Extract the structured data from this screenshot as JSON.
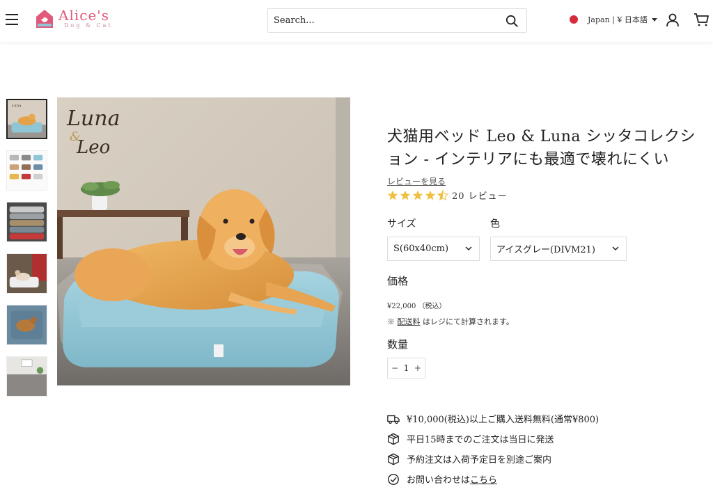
{
  "header": {
    "logo_name": "Alice's",
    "logo_sub": "Dog & Cat",
    "search_placeholder": "Search...",
    "locale_label": "Japan | ¥ 日本語"
  },
  "thumbnails": [
    {
      "name": "thumb-dog-on-bed"
    },
    {
      "name": "thumb-color-variations"
    },
    {
      "name": "thumb-stacked-beds"
    },
    {
      "name": "thumb-cat-on-bed"
    },
    {
      "name": "thumb-dog-top-view"
    },
    {
      "name": "thumb-room-view"
    }
  ],
  "main_image": {
    "brand_line1": "Luna",
    "brand_amp": "&",
    "brand_line2": "Leo"
  },
  "product": {
    "title": "犬猫用ベッド Leo & Luna シッタコレクション - インテリアにも最適で壊れにくい",
    "review_link": "レビューを見る",
    "rating": 4.5,
    "rating_count": "20 レビュー",
    "size_label": "サイズ",
    "size_value": "S(60x40cm)",
    "color_label": "色",
    "color_value": "アイスグレー(DIVM21)",
    "price_label": "価格",
    "price": "¥22,000 （税込）",
    "shipping_prefix": "※",
    "shipping_link": "配送料",
    "shipping_suffix": "はレジにて計算されます。",
    "qty_label": "数量",
    "qty_minus": "−",
    "qty_value": "1",
    "qty_plus": "+"
  },
  "features": [
    {
      "icon": "truck-icon",
      "text": "¥10,000(税込)以上ご購入送料無料(通常¥800)"
    },
    {
      "icon": "package-icon",
      "text": "平日15時までのご注文は当日に発送"
    },
    {
      "icon": "package-icon",
      "text": "予約注文は入荷予定日を別途ご案内"
    },
    {
      "icon": "check-circle-icon",
      "text_prefix": "お問い合わせは",
      "link": "こちら"
    }
  ],
  "colors": {
    "accent_pink": "#e0597a",
    "star_gold": "#f0c040",
    "flag_red": "#d62b3b",
    "bed_blue": "#8fc6d6"
  }
}
